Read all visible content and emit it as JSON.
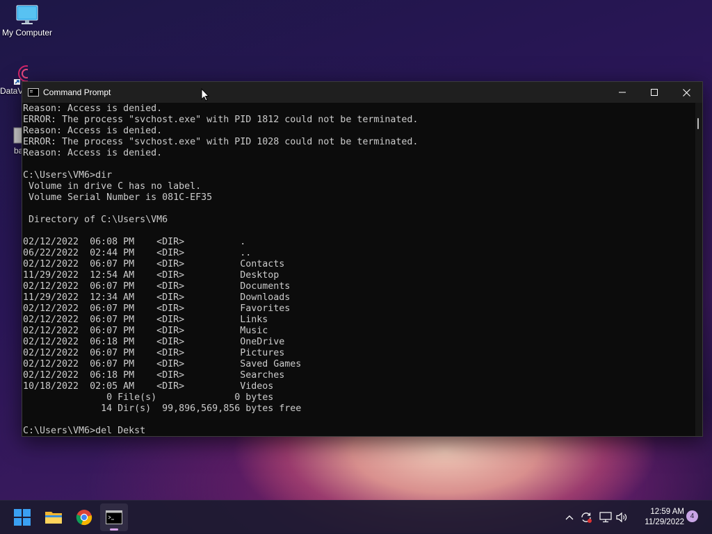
{
  "desktop": {
    "icons": [
      {
        "label": "My Computer"
      },
      {
        "label": "DataV"
      },
      {
        "label": "ba"
      }
    ]
  },
  "window": {
    "title": "Command Prompt",
    "lines": [
      "Reason: Access is denied.",
      "ERROR: The process \"svchost.exe\" with PID 1812 could not be terminated.",
      "Reason: Access is denied.",
      "ERROR: The process \"svchost.exe\" with PID 1028 could not be terminated.",
      "Reason: Access is denied.",
      "",
      "C:\\Users\\VM6>dir",
      " Volume in drive C has no label.",
      " Volume Serial Number is 081C-EF35",
      "",
      " Directory of C:\\Users\\VM6",
      "",
      "02/12/2022  06:08 PM    <DIR>          .",
      "06/22/2022  02:44 PM    <DIR>          ..",
      "02/12/2022  06:07 PM    <DIR>          Contacts",
      "11/29/2022  12:54 AM    <DIR>          Desktop",
      "02/12/2022  06:07 PM    <DIR>          Documents",
      "11/29/2022  12:34 AM    <DIR>          Downloads",
      "02/12/2022  06:07 PM    <DIR>          Favorites",
      "02/12/2022  06:07 PM    <DIR>          Links",
      "02/12/2022  06:07 PM    <DIR>          Music",
      "02/12/2022  06:18 PM    <DIR>          OneDrive",
      "02/12/2022  06:07 PM    <DIR>          Pictures",
      "02/12/2022  06:07 PM    <DIR>          Saved Games",
      "02/12/2022  06:18 PM    <DIR>          Searches",
      "10/18/2022  02:05 AM    <DIR>          Videos",
      "               0 File(s)              0 bytes",
      "              14 Dir(s)  99,896,569,856 bytes free",
      "",
      "C:\\Users\\VM6>del Dekst"
    ]
  },
  "taskbar": {
    "apps": [
      "start-icon",
      "file-explorer-icon",
      "chrome-icon",
      "command-prompt-icon"
    ],
    "tray": [
      "chevron-up-icon",
      "update-icon",
      "network-icon",
      "volume-icon"
    ],
    "clock": {
      "time": "12:59 AM",
      "date": "11/29/2022"
    },
    "notifications": "4"
  },
  "colors": {
    "console_bg": "#0c0c0c",
    "console_text": "#cccccc",
    "titlebar": "#1f1f1f",
    "taskbar": "#1c1a30"
  }
}
